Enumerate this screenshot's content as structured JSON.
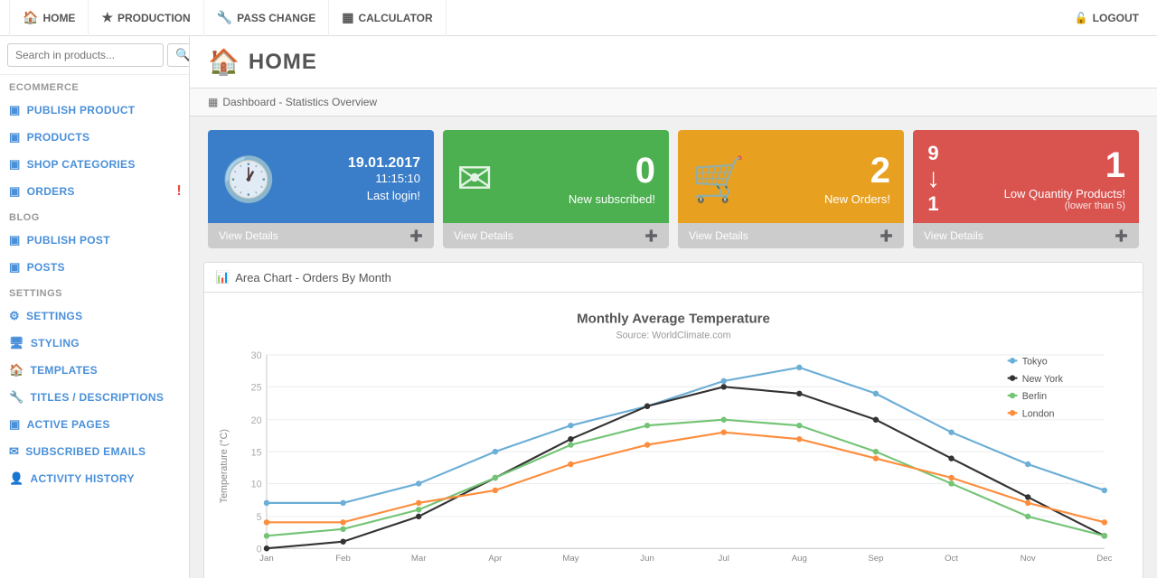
{
  "topNav": {
    "items": [
      {
        "id": "home",
        "label": "HOME",
        "icon": "🏠"
      },
      {
        "id": "production",
        "label": "PRODUCTION",
        "icon": "★"
      },
      {
        "id": "pass-change",
        "label": "PASS CHANGE",
        "icon": "🔧"
      },
      {
        "id": "calculator",
        "label": "CALCULATOR",
        "icon": "▦"
      }
    ],
    "logout_label": "LOGOUT",
    "logout_icon": "🔓"
  },
  "sidebar": {
    "search_placeholder": "Search in products...",
    "sections": [
      {
        "label": "ECOMMERCE",
        "items": [
          {
            "id": "publish-product",
            "label": "PUBLISH PRODUCT",
            "icon": "▣"
          },
          {
            "id": "products",
            "label": "PRODUCTS",
            "icon": "▣"
          },
          {
            "id": "shop-categories",
            "label": "SHOP CATEGORIES",
            "icon": "▣"
          },
          {
            "id": "orders",
            "label": "ORDERS",
            "icon": "▣",
            "badge": "!"
          }
        ]
      },
      {
        "label": "BLOG",
        "items": [
          {
            "id": "publish-post",
            "label": "PUBLISH POST",
            "icon": "▣"
          },
          {
            "id": "posts",
            "label": "POSTS",
            "icon": "▣"
          }
        ]
      },
      {
        "label": "SETTINGS",
        "items": [
          {
            "id": "settings",
            "label": "SETTINGS",
            "icon": "⚙"
          },
          {
            "id": "styling",
            "label": "STYLING",
            "icon": "🖥"
          },
          {
            "id": "templates",
            "label": "TEMPLATES",
            "icon": "🏠"
          },
          {
            "id": "titles-descriptions",
            "label": "TITLES / DESCRIPTIONS",
            "icon": "🔧"
          },
          {
            "id": "active-pages",
            "label": "ACTIVE PAGES",
            "icon": "▣"
          },
          {
            "id": "subscribed-emails",
            "label": "SUBSCRIBED EMAILS",
            "icon": "✉"
          },
          {
            "id": "activity-history",
            "label": "ACTIVITY HISTORY",
            "icon": "👤"
          }
        ]
      }
    ]
  },
  "page": {
    "title": "HOME",
    "breadcrumb": "Dashboard - Statistics Overview"
  },
  "cards": [
    {
      "id": "last-login",
      "color": "card-blue",
      "icon": "🕐",
      "date": "19.01.2017",
      "time": "11:15:10",
      "label": "Last login!",
      "footer": "View Details"
    },
    {
      "id": "new-subscribed",
      "color": "card-green",
      "icon": "✉",
      "number": "0",
      "label": "New subscribed!",
      "footer": "View Details"
    },
    {
      "id": "new-orders",
      "color": "card-orange",
      "icon": "🛒",
      "number": "2",
      "label": "New Orders!",
      "footer": "View Details"
    },
    {
      "id": "low-quantity",
      "color": "card-red",
      "number_top": "9",
      "number_bottom": "1",
      "main_number": "1",
      "label": "Low Quantity Products!",
      "sublabel": "(lower than 5)",
      "footer": "View Details"
    }
  ],
  "chart": {
    "section_label": "Area Chart - Orders By Month",
    "title": "Monthly Average Temperature",
    "subtitle": "Source: WorldClimate.com",
    "y_label": "Temperature (°C)",
    "y_max": 30,
    "legend": [
      {
        "city": "Tokyo",
        "color": "#6baed6"
      },
      {
        "city": "New York",
        "color": "#333"
      },
      {
        "city": "Berlin",
        "color": "#74c476"
      },
      {
        "city": "London",
        "color": "#fd8d3c"
      }
    ],
    "months": [
      "Jan",
      "Feb",
      "Mar",
      "Apr",
      "May",
      "Jun",
      "Jul",
      "Aug",
      "Sep",
      "Oct",
      "Nov",
      "Dec"
    ],
    "data": {
      "Tokyo": [
        7,
        7,
        10,
        15,
        19,
        22,
        26,
        28,
        24,
        18,
        13,
        9
      ],
      "New York": [
        0,
        1,
        5,
        11,
        17,
        22,
        25,
        24,
        20,
        14,
        8,
        2
      ],
      "Berlin": [
        2,
        3,
        6,
        11,
        16,
        19,
        20,
        19,
        15,
        10,
        5,
        2
      ],
      "London": [
        4,
        4,
        7,
        9,
        13,
        16,
        18,
        17,
        14,
        11,
        7,
        4
      ]
    }
  }
}
